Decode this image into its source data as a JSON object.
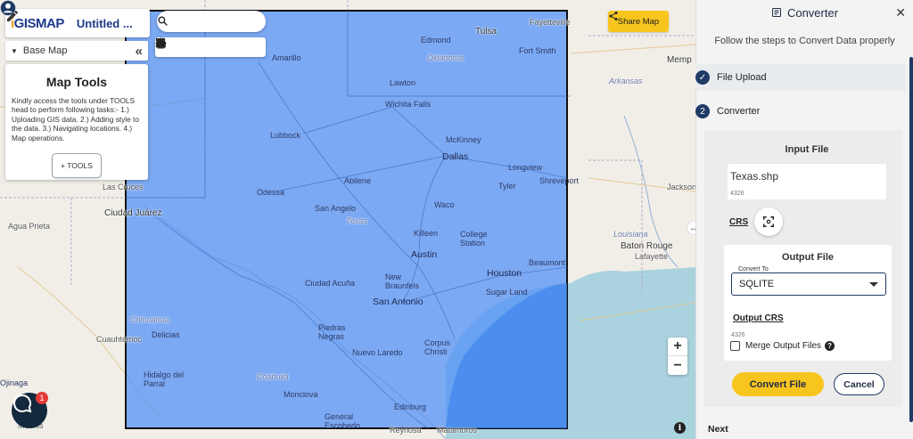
{
  "app": {
    "logo_prefix": "i",
    "logo_text": "GISMAP",
    "document_title": "Untitled ..."
  },
  "basemap": {
    "label": "Base Map"
  },
  "map_tools": {
    "title": "Map Tools",
    "description": "Kindly access the tools under TOOLS head to perform following tasks:- 1.) Uploading GIS data. 2.) Adding style to the data. 3.) Navigating locations. 4.) Map operations.",
    "button_label": "+ TOOLS"
  },
  "search": {
    "placeholder": ""
  },
  "share": {
    "label": "Share Map"
  },
  "zoom": {
    "in": "+",
    "out": "−"
  },
  "info_label": "i",
  "chat": {
    "badge": "1"
  },
  "map_labels": [
    {
      "text": "Tulsa",
      "cls": "big"
    },
    {
      "text": "Fayetteville",
      "cls": ""
    },
    {
      "text": "Edmond",
      "cls": "city-in"
    },
    {
      "text": "Oklahoma",
      "cls": "region"
    },
    {
      "text": "Fort Smith",
      "cls": "city-in"
    },
    {
      "text": "Memp",
      "cls": "big"
    },
    {
      "text": "Amarillo",
      "cls": "city-in"
    },
    {
      "text": "Lawton",
      "cls": "city-in"
    },
    {
      "text": "Arkansas",
      "cls": "region"
    },
    {
      "text": "Wichita Falls",
      "cls": "city-in"
    },
    {
      "text": "Lubbock",
      "cls": "city-in"
    },
    {
      "text": "McKinney",
      "cls": "city-in"
    },
    {
      "text": "Dallas",
      "cls": "city-in big"
    },
    {
      "text": "Longview",
      "cls": "city-in"
    },
    {
      "text": "Tyler",
      "cls": "city-in"
    },
    {
      "text": "Shreveport",
      "cls": "city-in"
    },
    {
      "text": "Abilene",
      "cls": "city-in"
    },
    {
      "text": "Jackson",
      "cls": ""
    },
    {
      "text": "Las Cruces",
      "cls": ""
    },
    {
      "text": "Odessa",
      "cls": "city-in"
    },
    {
      "text": "Ciudad Juárez",
      "cls": "big"
    },
    {
      "text": "San Angelo",
      "cls": "city-in"
    },
    {
      "text": "Texas",
      "cls": "region"
    },
    {
      "text": "Waco",
      "cls": "city-in"
    },
    {
      "text": "Agua Prieta",
      "cls": ""
    },
    {
      "text": "Killeen",
      "cls": "city-in"
    },
    {
      "text": "College Station",
      "cls": "city-in"
    },
    {
      "text": "Louisiana",
      "cls": "region"
    },
    {
      "text": "Baton Rouge",
      "cls": "big"
    },
    {
      "text": "Austin",
      "cls": "city-in big"
    },
    {
      "text": "Lafayette",
      "cls": ""
    },
    {
      "text": "Beaumont",
      "cls": "city-in"
    },
    {
      "text": "Houston",
      "cls": "city-in big"
    },
    {
      "text": "New Braunfels",
      "cls": "city-in"
    },
    {
      "text": "Ciudad Acuña",
      "cls": "city-in"
    },
    {
      "text": "Sugar Land",
      "cls": "city-in"
    },
    {
      "text": "San Antonio",
      "cls": "city-in big"
    },
    {
      "text": "Chihuahua",
      "cls": "region"
    },
    {
      "text": "Delicias",
      "cls": "city-in"
    },
    {
      "text": "Piedras Negras",
      "cls": "city-in"
    },
    {
      "text": "Cuauhtémoc",
      "cls": ""
    },
    {
      "text": "Corpus Christi",
      "cls": "city-in"
    },
    {
      "text": "Nuevo Laredo",
      "cls": "city-in"
    },
    {
      "text": "Hidalgo del Parral",
      "cls": "city-in"
    },
    {
      "text": "Ojinaga",
      "cls": "city-in"
    },
    {
      "text": "Coahuila",
      "cls": "region"
    },
    {
      "text": "Monclova",
      "cls": "city-in"
    },
    {
      "text": "Edinburg",
      "cls": "city-in"
    },
    {
      "text": "General Escobedo",
      "cls": "city-in"
    },
    {
      "text": "Reynosa",
      "cls": ""
    },
    {
      "text": "Matamoros",
      "cls": ""
    },
    {
      "text": "Mochis",
      "cls": ""
    }
  ],
  "panel": {
    "title": "Converter",
    "subtitle": "Follow the steps to Convert Data properly",
    "steps": [
      {
        "label": "File Upload",
        "state": "done"
      },
      {
        "label": "Converter",
        "number": "2"
      }
    ],
    "input": {
      "heading": "Input File",
      "file_name": "Texas.shp",
      "crs_value": "4326",
      "crs_label": "CRS"
    },
    "output": {
      "heading": "Output File",
      "convert_to_label": "Convert To",
      "selected": "SQLITE",
      "crs_label": "Output CRS",
      "crs_value": "4326",
      "merge_label": "Merge Output Files"
    },
    "convert_button": "Convert File",
    "cancel_button": "Cancel",
    "next_label": "Next"
  },
  "colors": {
    "accent_yellow": "#f7c51e",
    "brand_blue": "#1f3a64",
    "overlay_fill": "#4f8ff7"
  }
}
